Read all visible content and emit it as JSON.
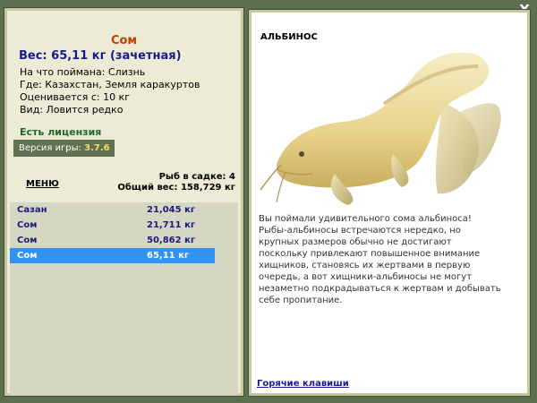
{
  "window": {
    "close_label": "X"
  },
  "fish": {
    "name": "Сом",
    "weight_line": "Вес: 65,11 кг (зачетная)",
    "caught_on": "На что поймана: Слизнь",
    "location": "Где: Казахстан, Земля каракуртов",
    "value": "Оценивается с: 10 кг",
    "rarity": "Вид: Ловится редко"
  },
  "license": "Есть лицензия",
  "version": {
    "label": "Версия игры: ",
    "value": "3.7.6"
  },
  "menu_label": "МЕНЮ",
  "cage": {
    "count_line": "Рыб в садке: 4",
    "total_line": "Общий вес: 158,729 кг"
  },
  "catches": [
    {
      "name": "Сазан",
      "weight": "21,045 кг",
      "selected": false
    },
    {
      "name": "Сом",
      "weight": "21,711 кг",
      "selected": false
    },
    {
      "name": "Сом",
      "weight": "50,862 кг",
      "selected": false
    },
    {
      "name": "Сом",
      "weight": "65,11 кг",
      "selected": true
    }
  ],
  "species": {
    "label": "АЛЬБИНОС",
    "description": "Вы поймали удивительного сома альбиноса! Рыбы-альбиносы встречаются нередко, но крупных размеров обычно не достигают поскольку привлекают повышенное внимание хищников, становясь их жертвами в первую очередь, а вот хищники-альбиносы не могут незаметно подкрадываться к жертвам и добывать себе пропитание."
  },
  "hotkeys_label": "Горячие клавиши",
  "colors": {
    "background": "#5c7050",
    "panel": "#ecebd6",
    "selected_row": "#2f93ef",
    "fish_title": "#c04000",
    "license": "#1e6a2a"
  }
}
